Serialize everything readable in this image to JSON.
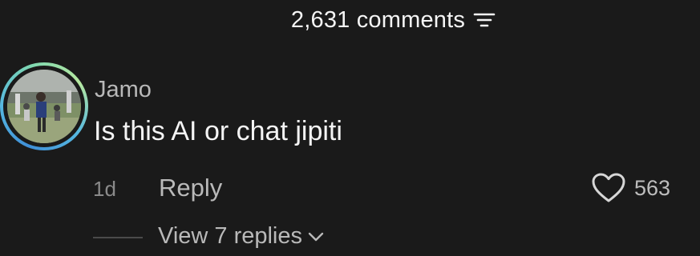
{
  "header": {
    "comment_count": "2,631 comments",
    "sort_icon": "sort-lines-icon"
  },
  "comment": {
    "avatar_icon": "user-avatar",
    "username": "Jamo",
    "text": "Is this AI or chat jipiti",
    "time": "1d",
    "reply_label": "Reply",
    "like_icon": "heart-outline-icon",
    "like_count": "563",
    "view_replies_label": "View 7 replies",
    "chevron_icon": "chevron-down-icon"
  },
  "colors": {
    "background": "#1a1a1a",
    "primary_text": "#f4f4f4",
    "secondary_text": "#b9b9b9",
    "muted_text": "#8a8a8a",
    "avatar_ring_start": "#3f8fd8",
    "avatar_ring_end": "#b6e8a0"
  }
}
